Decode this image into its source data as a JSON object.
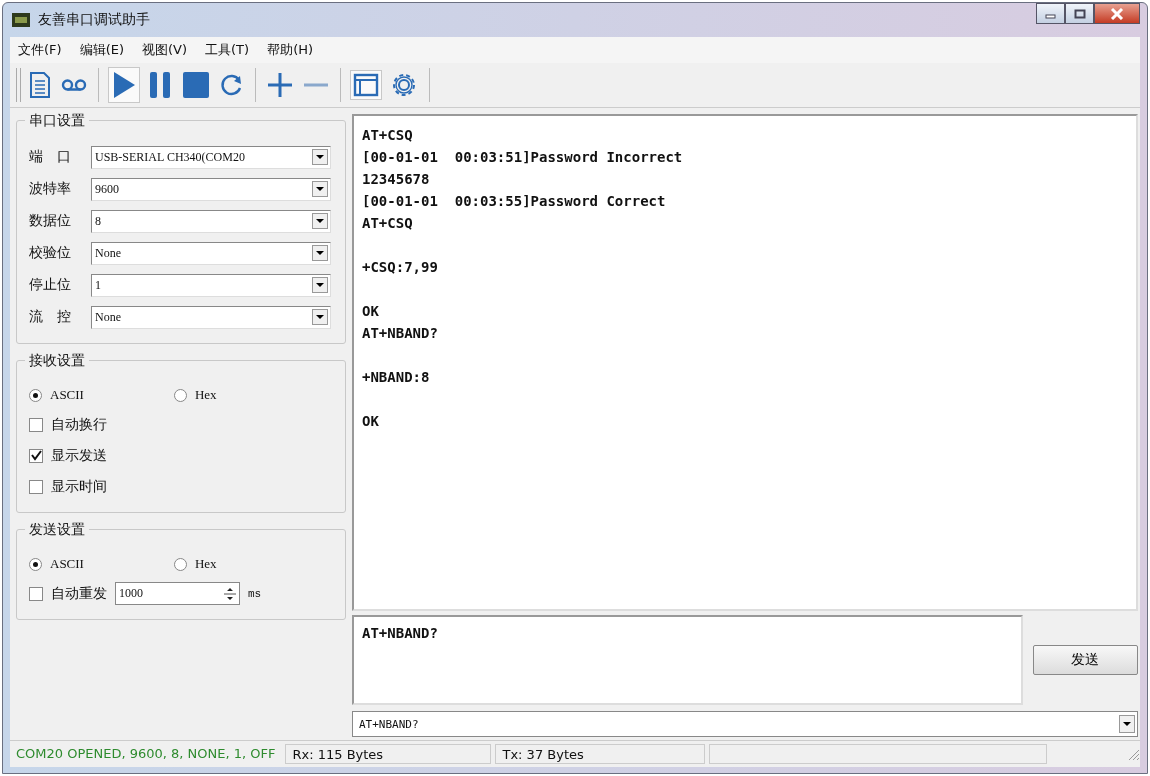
{
  "window": {
    "title": "友善串口调试助手"
  },
  "menu": [
    "文件(F)",
    "编辑(E)",
    "视图(V)",
    "工具(T)",
    "帮助(H)"
  ],
  "toolbar": [
    {
      "kind": "document"
    },
    {
      "kind": "tape"
    },
    {
      "kind": "sep"
    },
    {
      "kind": "play"
    },
    {
      "kind": "pause"
    },
    {
      "kind": "stop"
    },
    {
      "kind": "refresh"
    },
    {
      "kind": "sep"
    },
    {
      "kind": "plus"
    },
    {
      "kind": "minus"
    },
    {
      "kind": "sep"
    },
    {
      "kind": "window"
    },
    {
      "kind": "gear"
    },
    {
      "kind": "sep"
    }
  ],
  "serial_settings": {
    "title": "串口设置",
    "fields": [
      {
        "label": "端　口",
        "value": "USB-SERIAL CH340(COM20"
      },
      {
        "label": "波特率",
        "value": "9600"
      },
      {
        "label": "数据位",
        "value": "8"
      },
      {
        "label": "校验位",
        "value": "None"
      },
      {
        "label": "停止位",
        "value": "1"
      },
      {
        "label": "流　控",
        "value": "None"
      }
    ]
  },
  "receive_settings": {
    "title": "接收设置",
    "modes": [
      {
        "label": "ASCII",
        "selected": true
      },
      {
        "label": "Hex",
        "selected": false
      }
    ],
    "options": [
      {
        "label": "自动换行",
        "checked": false
      },
      {
        "label": "显示发送",
        "checked": true
      },
      {
        "label": "显示时间",
        "checked": false
      }
    ]
  },
  "send_settings": {
    "title": "发送设置",
    "modes": [
      {
        "label": "ASCII",
        "selected": true
      },
      {
        "label": "Hex",
        "selected": false
      }
    ],
    "auto_resend": {
      "label": "自动重发",
      "checked": false,
      "value": "1000",
      "unit": "ms"
    }
  },
  "receive_text": "AT+CSQ\n[00-01-01  00:03:51]Password Incorrect\n12345678\n[00-01-01  00:03:55]Password Correct\nAT+CSQ\n\n+CSQ:7,99\n\nOK\nAT+NBAND?\n\n+NBAND:8\n\nOK",
  "send_text": "AT+NBAND?",
  "send_button": "发送",
  "history": "AT+NBAND?",
  "status_bar": [
    "COM20 OPENED, 9600, 8, NONE, 1, OFF",
    "Rx: 115 Bytes",
    "Tx: 37 Bytes"
  ]
}
